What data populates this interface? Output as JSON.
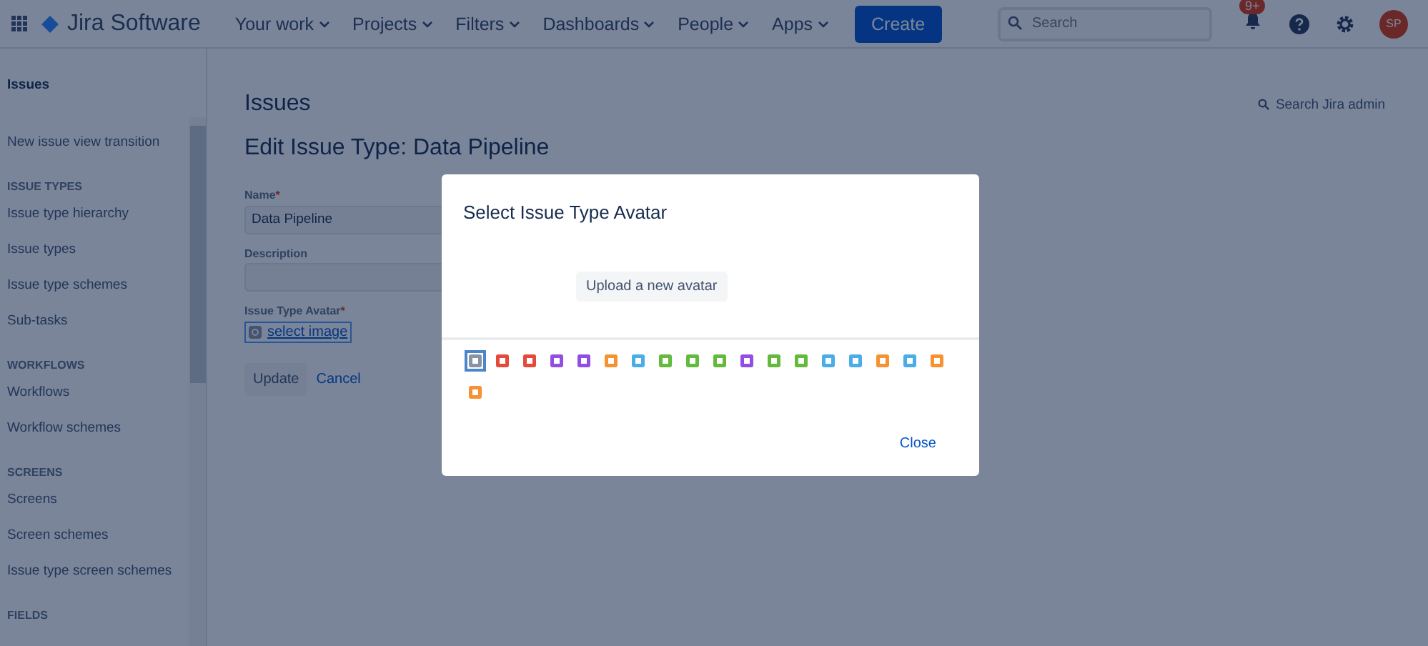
{
  "topbar": {
    "product": "Jira Software",
    "nav": [
      {
        "label": "Your work"
      },
      {
        "label": "Projects"
      },
      {
        "label": "Filters"
      },
      {
        "label": "Dashboards"
      },
      {
        "label": "People"
      },
      {
        "label": "Apps"
      }
    ],
    "create": "Create",
    "search": {
      "placeholder": "Search"
    },
    "notifications": "9+",
    "avatar": "SP"
  },
  "sidebar": {
    "title": "Issues",
    "items": [
      {
        "kind": "link",
        "label": "New issue view transition"
      },
      {
        "kind": "heading",
        "label": "ISSUE TYPES"
      },
      {
        "kind": "link",
        "label": "Issue type hierarchy"
      },
      {
        "kind": "link",
        "label": "Issue types"
      },
      {
        "kind": "link",
        "label": "Issue type schemes"
      },
      {
        "kind": "link",
        "label": "Sub-tasks"
      },
      {
        "kind": "heading",
        "label": "WORKFLOWS"
      },
      {
        "kind": "link",
        "label": "Workflows"
      },
      {
        "kind": "link",
        "label": "Workflow schemes"
      },
      {
        "kind": "heading",
        "label": "SCREENS"
      },
      {
        "kind": "link",
        "label": "Screens"
      },
      {
        "kind": "link",
        "label": "Screen schemes"
      },
      {
        "kind": "link",
        "label": "Issue type screen schemes"
      },
      {
        "kind": "heading",
        "label": "FIELDS"
      }
    ]
  },
  "main": {
    "section": "Issues",
    "admin_search": "Search Jira admin",
    "heading": "Edit Issue Type: Data Pipeline",
    "form": {
      "required_mark": "*",
      "name_label": "Name",
      "name_value": "Data Pipeline",
      "description_label": "Description",
      "avatar_label": "Issue Type Avatar",
      "select_image": "select image",
      "update": "Update",
      "cancel": "Cancel"
    }
  },
  "dialog": {
    "title": "Select Issue Type Avatar",
    "upload": "Upload a new avatar",
    "close": "Close",
    "avatars": [
      {
        "color": "#8993a4",
        "selected": true
      },
      {
        "color": "#e5493a",
        "selected": false
      },
      {
        "color": "#e5493a",
        "selected": false
      },
      {
        "color": "#904ee2",
        "selected": false
      },
      {
        "color": "#904ee2",
        "selected": false
      },
      {
        "color": "#f79232",
        "selected": false
      },
      {
        "color": "#4bade8",
        "selected": false
      },
      {
        "color": "#63ba3c",
        "selected": false
      },
      {
        "color": "#63ba3c",
        "selected": false
      },
      {
        "color": "#63ba3c",
        "selected": false
      },
      {
        "color": "#904ee2",
        "selected": false
      },
      {
        "color": "#63ba3c",
        "selected": false
      },
      {
        "color": "#63ba3c",
        "selected": false
      },
      {
        "color": "#4bade8",
        "selected": false
      },
      {
        "color": "#4bade8",
        "selected": false
      },
      {
        "color": "#f79232",
        "selected": false
      },
      {
        "color": "#4bade8",
        "selected": false
      },
      {
        "color": "#f79232",
        "selected": false
      },
      {
        "color": "#f79232",
        "selected": false
      }
    ]
  }
}
